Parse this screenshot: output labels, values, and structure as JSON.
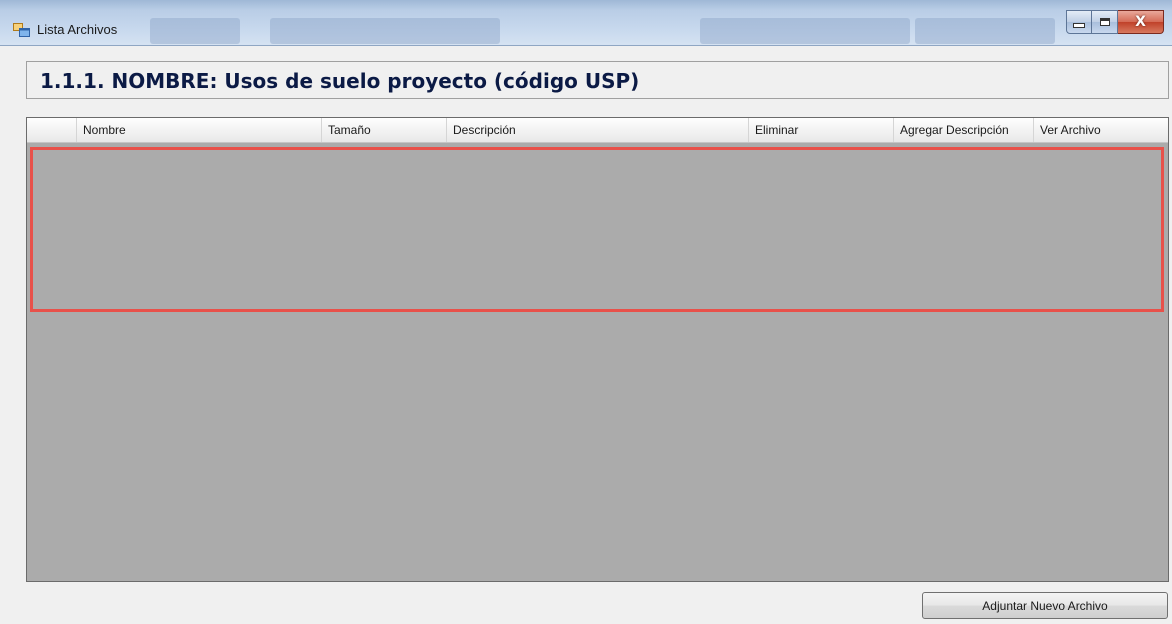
{
  "window": {
    "title": "Lista Archivos",
    "icon": "app-window-icon"
  },
  "caption_buttons": {
    "minimize_icon": "minimize-icon",
    "maximize_icon": "maximize-icon",
    "close_icon": "close-icon",
    "close_glyph": "X"
  },
  "header": {
    "title": "1.1.1. NOMBRE: Usos de suelo proyecto (código USP)"
  },
  "grid": {
    "columns": [
      "Nombre",
      "Tamaño",
      "Descripción",
      "Eliminar",
      "Agregar Descripción",
      "Ver Archivo"
    ],
    "rows": []
  },
  "actions": {
    "add_file_label": "Adjuntar Nuevo Archivo"
  },
  "colors": {
    "highlight": "#e8514a",
    "grid_background": "#ababab",
    "title_text": "#0b1a45"
  }
}
